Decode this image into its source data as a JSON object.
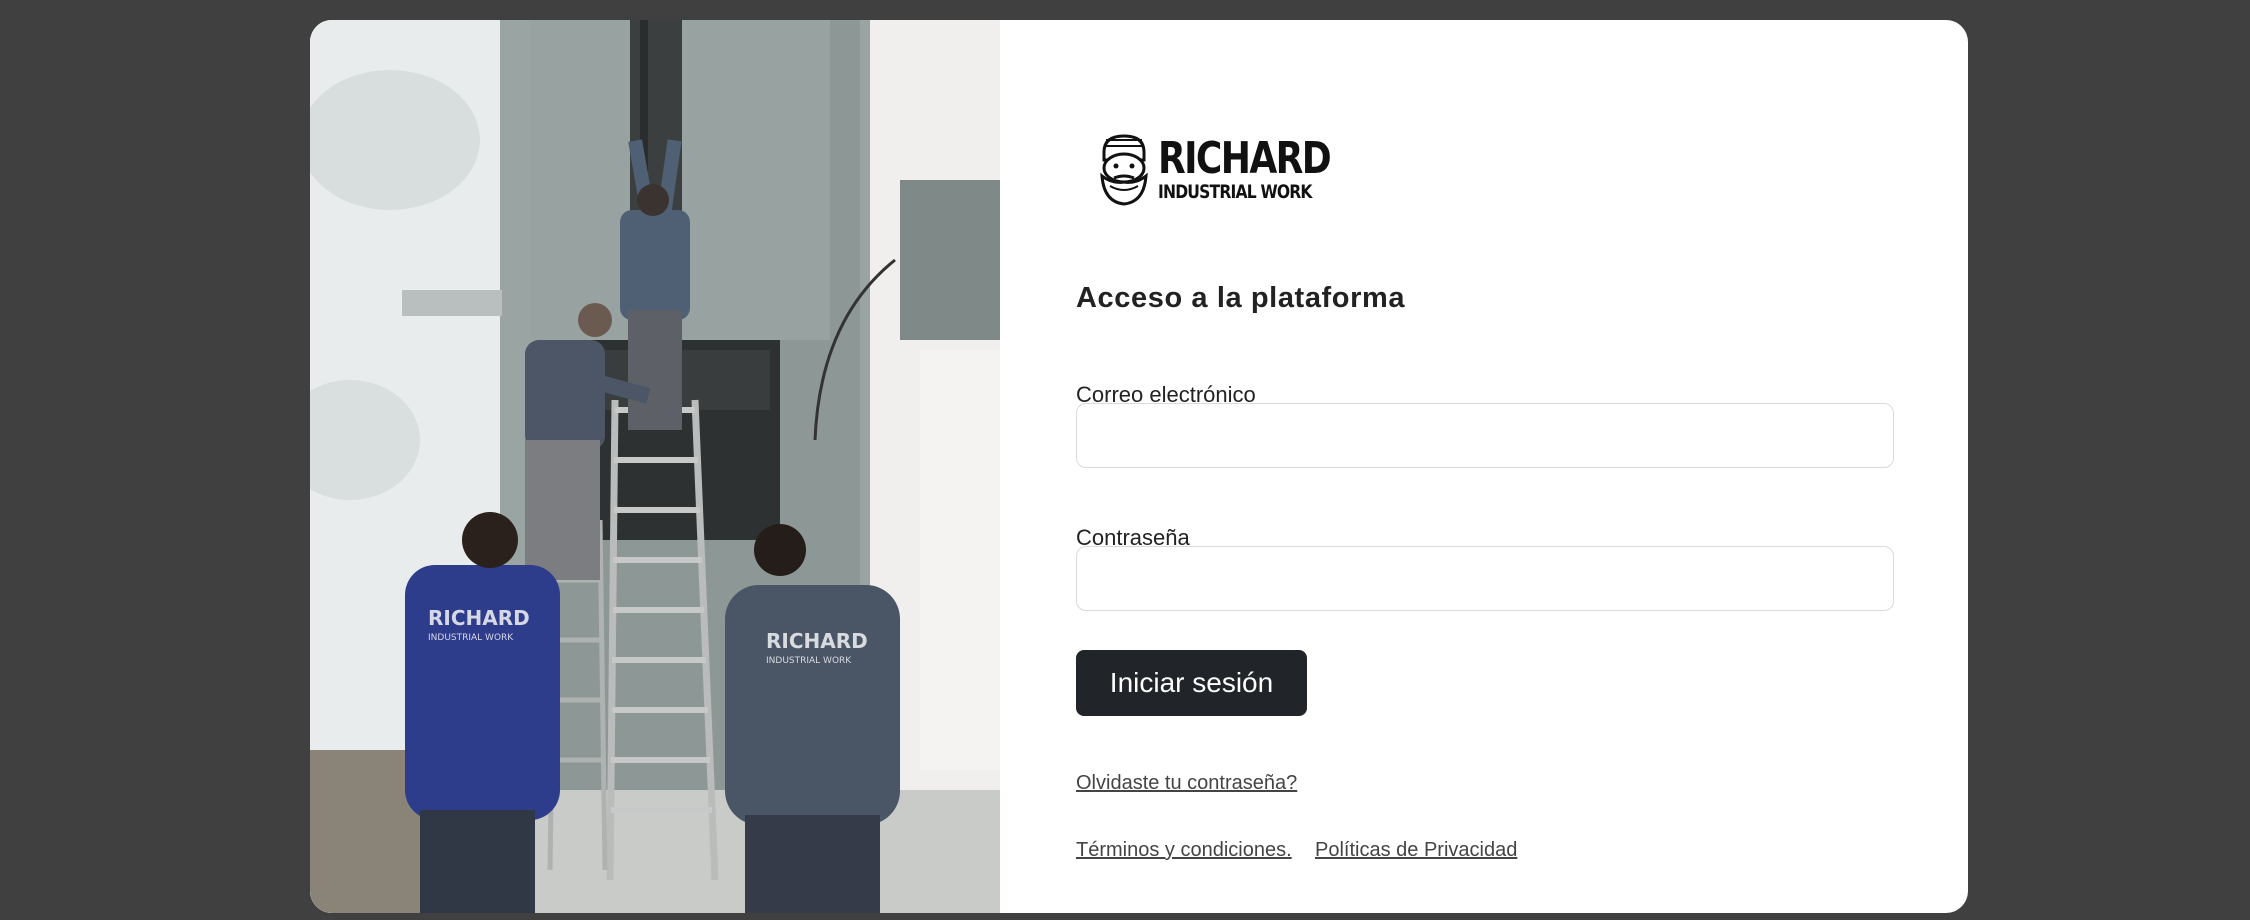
{
  "brand": {
    "name": "RICHARD",
    "tagline": "INDUSTRIAL WORK"
  },
  "photo": {
    "jacket_logo_name": "RICHARD",
    "jacket_logo_tagline": "INDUSTRIAL WORK"
  },
  "login": {
    "title": "Acceso a la plataforma",
    "email_label": "Correo electrónico",
    "email_value": "",
    "password_label": "Contraseña",
    "password_value": "",
    "submit_label": "Iniciar sesión",
    "forgot_link": "Olvidaste tu contraseña?",
    "terms_link": "Términos y condiciones.",
    "privacy_link": "Políticas de Privacidad"
  },
  "colors": {
    "background": "#404040",
    "card": "#ffffff",
    "button": "#212529",
    "button_text": "#ffffff"
  }
}
